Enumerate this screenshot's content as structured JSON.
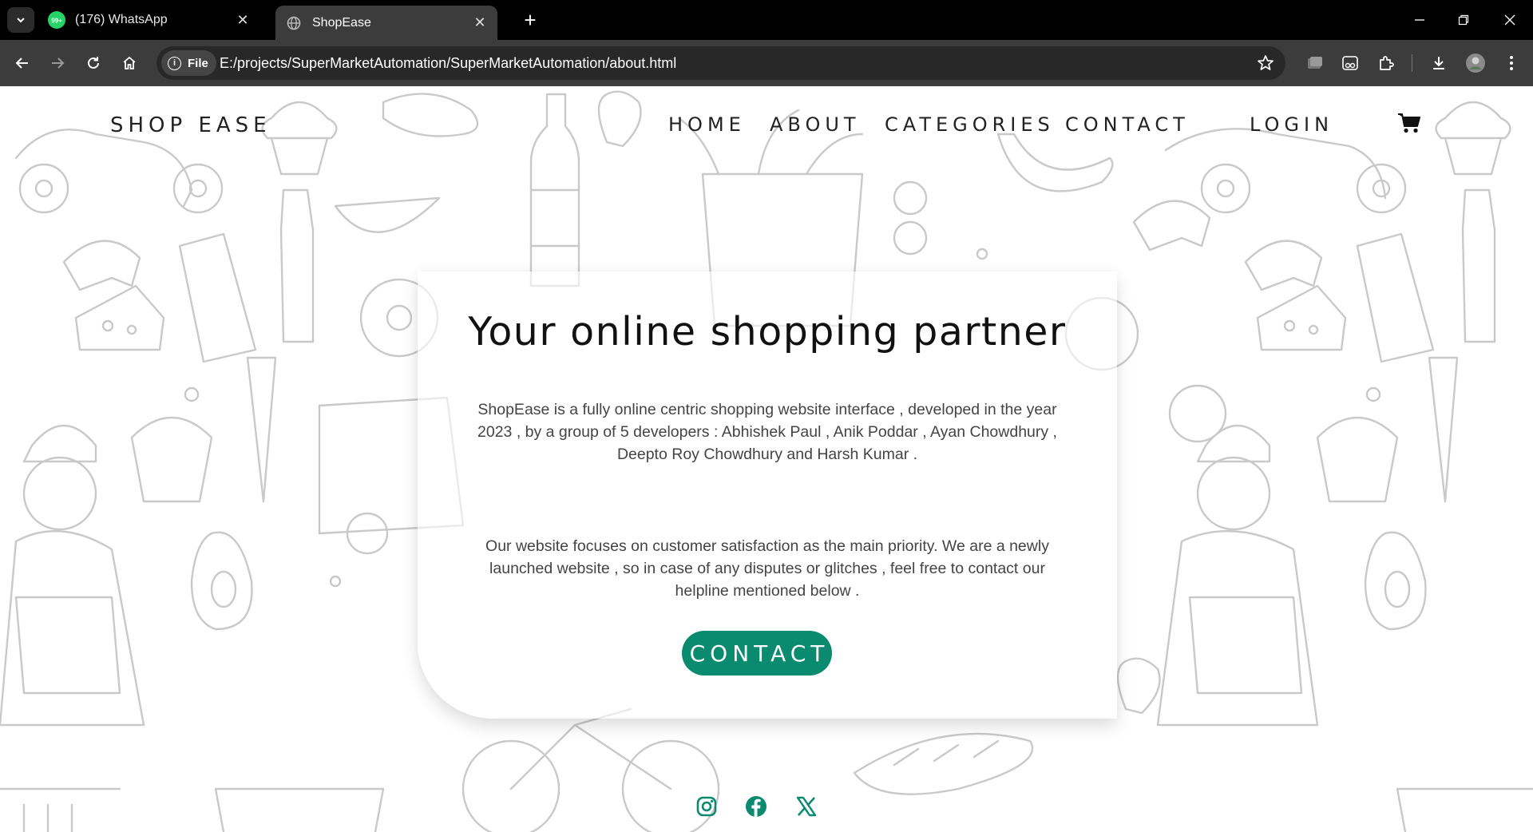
{
  "browser": {
    "tabs": [
      {
        "title": "(176) WhatsApp",
        "badge": "99+",
        "active": false
      },
      {
        "title": "ShopEase",
        "active": true
      }
    ],
    "address": {
      "scheme_label": "File",
      "url": "E:/projects/SuperMarketAutomation/SuperMarketAutomation/about.html"
    }
  },
  "nav": {
    "brand": "SHOP EASE",
    "items": [
      "HOME",
      "ABOUT",
      "CATEGORIES",
      "CONTACT",
      "LOGIN"
    ]
  },
  "about": {
    "title": "Your online shopping partner",
    "paragraph1": "ShopEase is a fully online centric shopping website interface , developed in the year 2023 , by a group of 5 developers : Abhishek Paul , Anik Poddar , Ayan Chowdhury , Deepto Roy Chowdhury and Harsh Kumar .",
    "paragraph2": "Our website focuses on customer satisfaction as the main priority. We are a newly launched website , so in case of any disputes or glitches , feel free to contact our helpline mentioned below .",
    "button": "CONTACT"
  },
  "footer": {
    "social_icons": [
      "instagram-icon",
      "facebook-icon",
      "x-icon"
    ]
  },
  "colors": {
    "accent": "#0a8a6f",
    "doodle": "#c9c9c9",
    "text": "#222222"
  }
}
